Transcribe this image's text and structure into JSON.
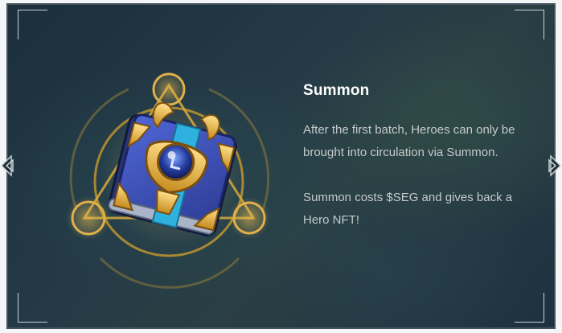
{
  "card": {
    "title": "Summon",
    "paragraphs": [
      "After the first batch, Heroes can only be brought into circulation via Summon.",
      "Summon costs $SEG and gives back a Hero NFT!"
    ]
  },
  "navigation": {
    "prev_icon": "chevron-left-icon",
    "next_icon": "chevron-right-icon"
  },
  "emblem": {
    "icon": "summon-book-icon"
  },
  "colors": {
    "background": "#243a46",
    "gold": "#c99a2c",
    "book_blue": "#3a4fb5",
    "title": "#ffffff",
    "body_text": "#c6cacb",
    "frame_line": "#c9d2d6"
  }
}
